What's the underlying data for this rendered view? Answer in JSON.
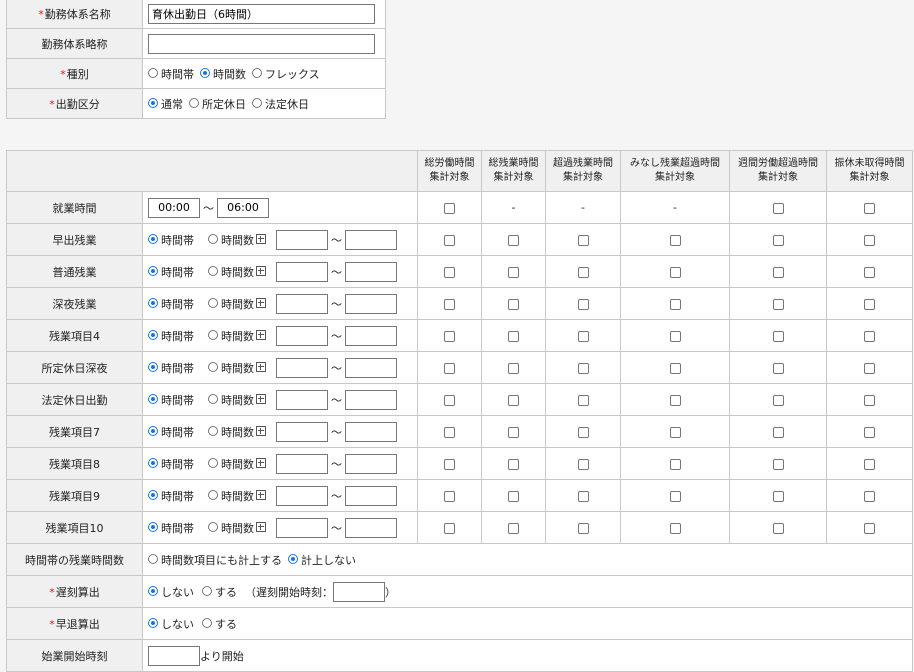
{
  "basic": {
    "name_label": "勤務体系名称",
    "name_value": "育休出勤日（6時間）",
    "abbrev_label": "勤務体系略称",
    "abbrev_value": "",
    "type_label": "種別",
    "type_options": [
      "時間帯",
      "時間数",
      "フレックス"
    ],
    "type_selected": 1,
    "attendance_label": "出勤区分",
    "attendance_options": [
      "通常",
      "所定休日",
      "法定休日"
    ],
    "attendance_selected": 0,
    "required_mark": "*"
  },
  "detail": {
    "column_headers": [
      [
        "総労働時間",
        "集計対象"
      ],
      [
        "総残業時間",
        "集計対象"
      ],
      [
        "超過残業時間",
        "集計対象"
      ],
      [
        "みなし残業超過時間",
        "集計対象"
      ],
      [
        "週間労働超過時間",
        "集計対象"
      ],
      [
        "振休未取得時間",
        "集計対象"
      ]
    ],
    "work_row": {
      "label": "就業時間",
      "start": "00:00",
      "tilde": "～",
      "end": "06:00",
      "cells": [
        "chk",
        "-",
        "-",
        "-",
        "chk",
        "chk"
      ]
    },
    "overtime_rows": [
      {
        "label": "早出残業"
      },
      {
        "label": "普通残業"
      },
      {
        "label": "深夜残業"
      },
      {
        "label": "残業項目4"
      },
      {
        "label": "所定休日深夜"
      },
      {
        "label": "法定休日出勤"
      },
      {
        "label": "残業項目7"
      },
      {
        "label": "残業項目8"
      },
      {
        "label": "残業項目9"
      },
      {
        "label": "残業項目10"
      }
    ],
    "overtime_mode_options": [
      "時間帯",
      "時間数"
    ],
    "overtime_mode_selected": 0,
    "timeband_overtime": {
      "label": "時間帯の残業時間数",
      "options": [
        "時間数項目にも計上する",
        "計上しない"
      ],
      "selected": 1
    },
    "late": {
      "label": "遅刻算出",
      "options": [
        "しない",
        "する"
      ],
      "selected": 0,
      "extra_prefix": "（遅刻開始時刻：",
      "extra_suffix": "）",
      "start_value": ""
    },
    "early": {
      "label": "早退算出",
      "options": [
        "しない",
        "する"
      ],
      "selected": 0
    },
    "start_time": {
      "label": "始業開始時刻",
      "value": "",
      "suffix": "より開始"
    }
  }
}
